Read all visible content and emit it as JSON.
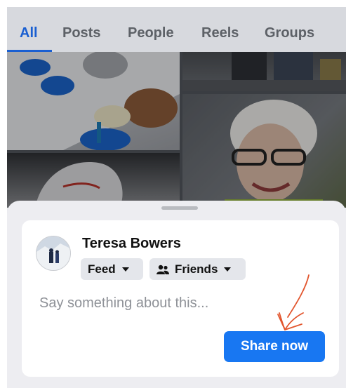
{
  "tabs": [
    {
      "label": "All",
      "active": true
    },
    {
      "label": "Posts",
      "active": false
    },
    {
      "label": "People",
      "active": false
    },
    {
      "label": "Reels",
      "active": false
    },
    {
      "label": "Groups",
      "active": false
    }
  ],
  "share_sheet": {
    "user_name": "Teresa Bowers",
    "destination": "Feed",
    "audience": "Friends",
    "placeholder": "Say something about this...",
    "share_button": "Share now"
  },
  "colors": {
    "accent": "#1877f2",
    "active_tab": "#1a5fd1",
    "annotation": "#e2552d"
  },
  "icons": [
    "caret-down-icon",
    "friends-icon",
    "avatar",
    "annotation-arrow-icon"
  ]
}
